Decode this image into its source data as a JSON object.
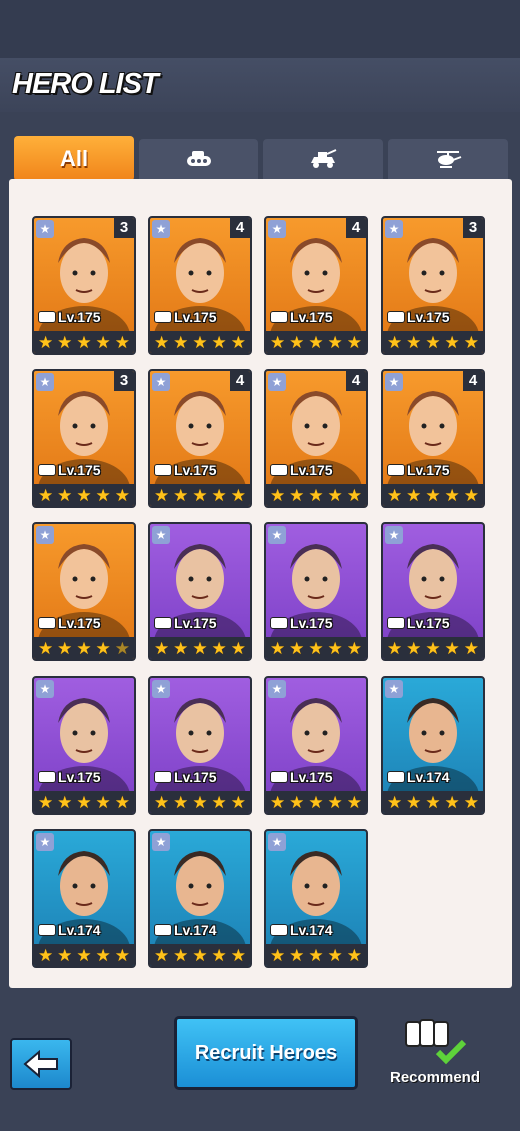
{
  "header": {
    "title": "HERO LIST"
  },
  "tabs": [
    {
      "label": "All",
      "active": true,
      "icon": "all"
    },
    {
      "label": "",
      "active": false,
      "icon": "tank-icon"
    },
    {
      "label": "",
      "active": false,
      "icon": "armored-vehicle-icon"
    },
    {
      "label": "",
      "active": false,
      "icon": "helicopter-icon"
    }
  ],
  "heroes": [
    {
      "rank": "3",
      "level": "Lv.175",
      "rarity": "orange",
      "stars": 5,
      "unit": "helicopter-icon"
    },
    {
      "rank": "4",
      "level": "Lv.175",
      "rarity": "orange",
      "stars": 5,
      "unit": "tank-icon"
    },
    {
      "rank": "4",
      "level": "Lv.175",
      "rarity": "orange",
      "stars": 5,
      "unit": "tank-icon"
    },
    {
      "rank": "3",
      "level": "Lv.175",
      "rarity": "orange",
      "stars": 5,
      "unit": "helicopter-icon"
    },
    {
      "rank": "3",
      "level": "Lv.175",
      "rarity": "orange",
      "stars": 5,
      "unit": "helicopter-icon"
    },
    {
      "rank": "4",
      "level": "Lv.175",
      "rarity": "orange",
      "stars": 5,
      "unit": "tank-icon"
    },
    {
      "rank": "4",
      "level": "Lv.175",
      "rarity": "orange",
      "stars": 5,
      "unit": "armored-vehicle-icon"
    },
    {
      "rank": "4",
      "level": "Lv.175",
      "rarity": "orange",
      "stars": 5,
      "unit": "armored-vehicle-icon"
    },
    {
      "rank": "",
      "level": "Lv.175",
      "rarity": "orange",
      "stars": 4.5,
      "unit": "armored-vehicle-icon"
    },
    {
      "rank": "",
      "level": "Lv.175",
      "rarity": "purple",
      "stars": 5,
      "unit": "tank-icon"
    },
    {
      "rank": "",
      "level": "Lv.175",
      "rarity": "purple",
      "stars": 5,
      "unit": "armored-vehicle-icon"
    },
    {
      "rank": "",
      "level": "Lv.175",
      "rarity": "purple",
      "stars": 5,
      "unit": "armored-vehicle-icon"
    },
    {
      "rank": "",
      "level": "Lv.175",
      "rarity": "purple",
      "stars": 5,
      "unit": "tank-icon"
    },
    {
      "rank": "",
      "level": "Lv.175",
      "rarity": "purple",
      "stars": 5,
      "unit": "tank-icon"
    },
    {
      "rank": "",
      "level": "Lv.175",
      "rarity": "purple",
      "stars": 5,
      "unit": "tank-icon"
    },
    {
      "rank": "",
      "level": "Lv.174",
      "rarity": "blue",
      "stars": 5,
      "unit": "tank-icon"
    },
    {
      "rank": "",
      "level": "Lv.174",
      "rarity": "blue",
      "stars": 5,
      "unit": "tank-icon"
    },
    {
      "rank": "",
      "level": "Lv.174",
      "rarity": "blue",
      "stars": 5,
      "unit": "armored-vehicle-icon"
    },
    {
      "rank": "",
      "level": "Lv.174",
      "rarity": "blue",
      "stars": 5,
      "unit": "armored-vehicle-icon"
    }
  ],
  "footer": {
    "recruit_label": "Recruit Heroes",
    "recommend_label": "Recommend"
  },
  "colors": {
    "orange": "#f0841a",
    "purple": "#8a4cd4",
    "blue": "#239ad0",
    "star": "#ffc21a"
  }
}
